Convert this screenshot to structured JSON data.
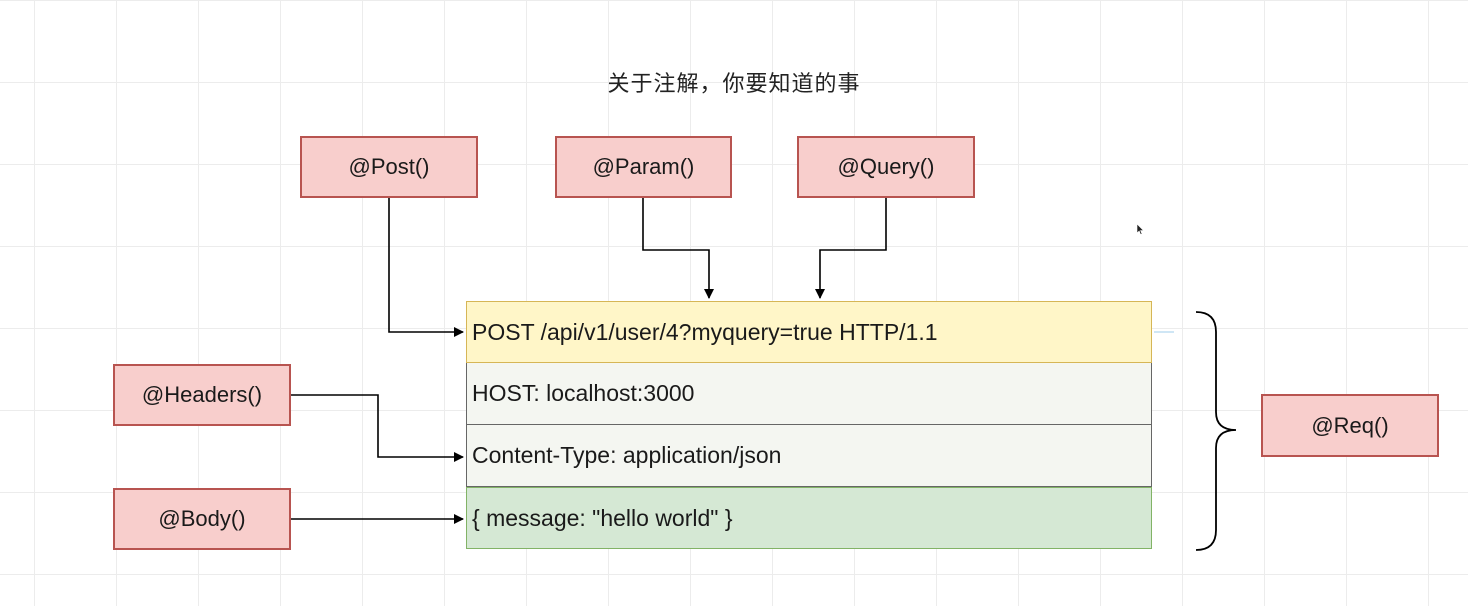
{
  "title": "关于注解，你要知道的事",
  "annotations": {
    "post": "@Post()",
    "param": "@Param()",
    "query": "@Query()",
    "headers": "@Headers()",
    "body": "@Body()",
    "req": "@Req()"
  },
  "request": {
    "request_line": "POST /api/v1/user/4?myquery=true HTTP/1.1",
    "host_header": "HOST: localhost:3000",
    "content_type_header": "Content-Type: application/json",
    "body": "{ message: \"hello world\" }"
  },
  "colors": {
    "annotation_fill": "#f8cecc",
    "annotation_stroke": "#b85450",
    "request_line_fill": "#fff6c8",
    "request_line_stroke": "#d6b656",
    "header_fill": "#f4f6f1",
    "header_stroke": "#666666",
    "body_fill": "#d5e8d4",
    "body_stroke": "#82b366",
    "connector": "#000000"
  },
  "icons": {
    "arrow_head": "filled-triangle-arrow",
    "brace": "right-curly-brace",
    "cursor": "mouse-pointer-icon"
  }
}
